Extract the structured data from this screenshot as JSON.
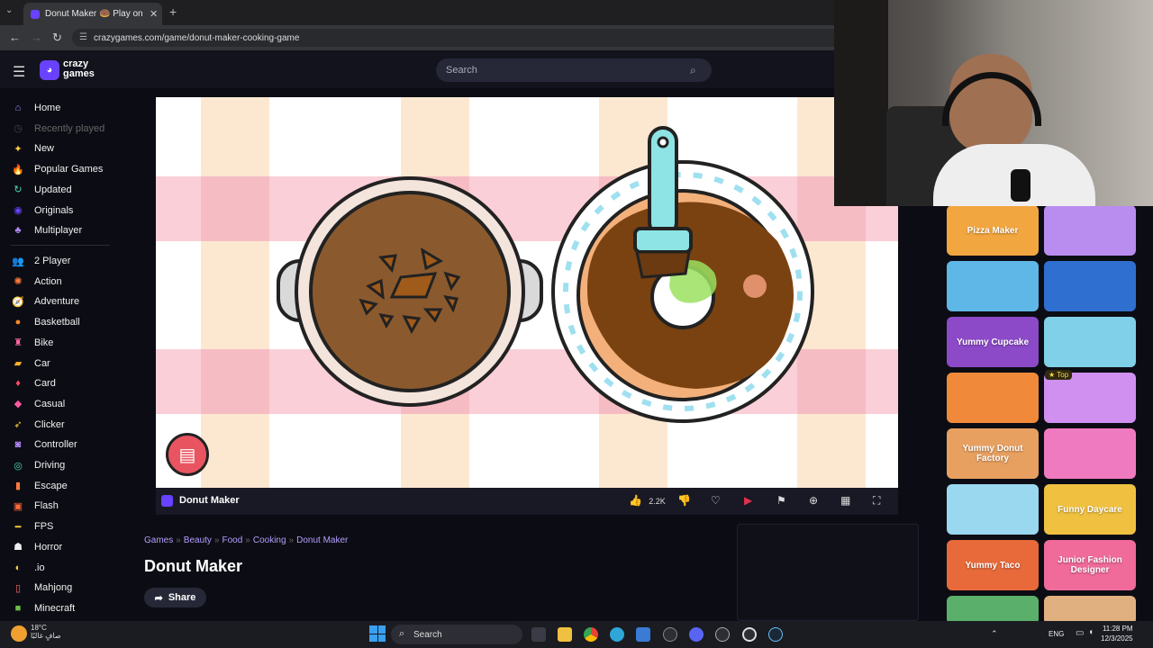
{
  "browser": {
    "tab_title": "Donut Maker 🍩 Play on CrazyGames",
    "tab_close": "✕",
    "new_tab": "+",
    "url": "crazygames.com/game/donut-maker-cooking-game"
  },
  "header": {
    "logo_line1": "crazy",
    "logo_line2": "games",
    "search_placeholder": "Search"
  },
  "sidebar": {
    "primary": [
      {
        "label": "Home",
        "icon": "⌂",
        "color": "#9f8cff"
      },
      {
        "label": "Recently played",
        "icon": "◷",
        "color": "#445"
      },
      {
        "label": "New",
        "icon": "✦",
        "color": "#ffcf3b"
      },
      {
        "label": "Popular Games",
        "icon": "🔥",
        "color": "#ff6a3b"
      },
      {
        "label": "Updated",
        "icon": "↻",
        "color": "#4cd9b0"
      },
      {
        "label": "Originals",
        "icon": "◉",
        "color": "#6842ff"
      },
      {
        "label": "Multiplayer",
        "icon": "♣",
        "color": "#b48cff"
      }
    ],
    "categories": [
      {
        "label": "2 Player",
        "icon": "👥",
        "color": "#6aa0ff"
      },
      {
        "label": "Action",
        "icon": "✺",
        "color": "#ff7a3b"
      },
      {
        "label": "Adventure",
        "icon": "🧭",
        "color": "#ff5a5a"
      },
      {
        "label": "Basketball",
        "icon": "●",
        "color": "#ff8a2b"
      },
      {
        "label": "Bike",
        "icon": "♜",
        "color": "#ff6aa0"
      },
      {
        "label": "Car",
        "icon": "▰",
        "color": "#ffb02b"
      },
      {
        "label": "Card",
        "icon": "♦",
        "color": "#ff4a6a"
      },
      {
        "label": "Casual",
        "icon": "◆",
        "color": "#ff5aa0"
      },
      {
        "label": "Clicker",
        "icon": "➶",
        "color": "#ffcf3b"
      },
      {
        "label": "Controller",
        "icon": "◙",
        "color": "#b48cff"
      },
      {
        "label": "Driving",
        "icon": "◎",
        "color": "#4cd9b0"
      },
      {
        "label": "Escape",
        "icon": "▮",
        "color": "#ff7a3b"
      },
      {
        "label": "Flash",
        "icon": "▣",
        "color": "#ff6a3b"
      },
      {
        "label": "FPS",
        "icon": "━",
        "color": "#ffcf3b"
      },
      {
        "label": "Horror",
        "icon": "☗",
        "color": "#eeeeee"
      },
      {
        "label": ".io",
        "icon": "◐",
        "color": "#ffcf3b"
      },
      {
        "label": "Mahjong",
        "icon": "▯",
        "color": "#ff6a6a"
      },
      {
        "label": "Minecraft",
        "icon": "■",
        "color": "#6ac04a"
      }
    ]
  },
  "game": {
    "title": "Donut Maker",
    "likes": "2.2K",
    "breadcrumbs": [
      "Games",
      "Beauty",
      "Food",
      "Cooking",
      "Donut Maker"
    ],
    "page_title": "Donut Maker",
    "share_label": "Share"
  },
  "rail": {
    "top_badge": "Top",
    "thumbs": [
      {
        "label": "Pizza Maker",
        "bg": "#f2a640"
      },
      {
        "label": "",
        "bg": "#b98cf0"
      },
      {
        "label": "",
        "bg": "#5fb7e8"
      },
      {
        "label": "",
        "bg": "#2f6fd0"
      },
      {
        "label": "Yummy Cupcake",
        "bg": "#8c4ac8"
      },
      {
        "label": "",
        "bg": "#7fd0e8"
      },
      {
        "label": "",
        "bg": "#f08a3a"
      },
      {
        "label": "",
        "bg": "#d090f0"
      },
      {
        "label": "Yummy Donut Factory",
        "bg": "#e8a060"
      },
      {
        "label": "",
        "bg": "#f07ac0"
      },
      {
        "label": "",
        "bg": "#9ad8f0"
      },
      {
        "label": "Funny Daycare",
        "bg": "#f0c040"
      },
      {
        "label": "Yummy Taco",
        "bg": "#e86a3a"
      },
      {
        "label": "Junior Fashion Designer",
        "bg": "#f06a9a"
      },
      {
        "label": "",
        "bg": "#5ab06a"
      },
      {
        "label": "",
        "bg": "#e0b080"
      }
    ]
  },
  "taskbar": {
    "temp": "18°C",
    "weather_text": "صافٍ غالبًا",
    "search": "Search",
    "lang": "ENG",
    "time": "11:28 PM",
    "date": "12/3/2025"
  }
}
